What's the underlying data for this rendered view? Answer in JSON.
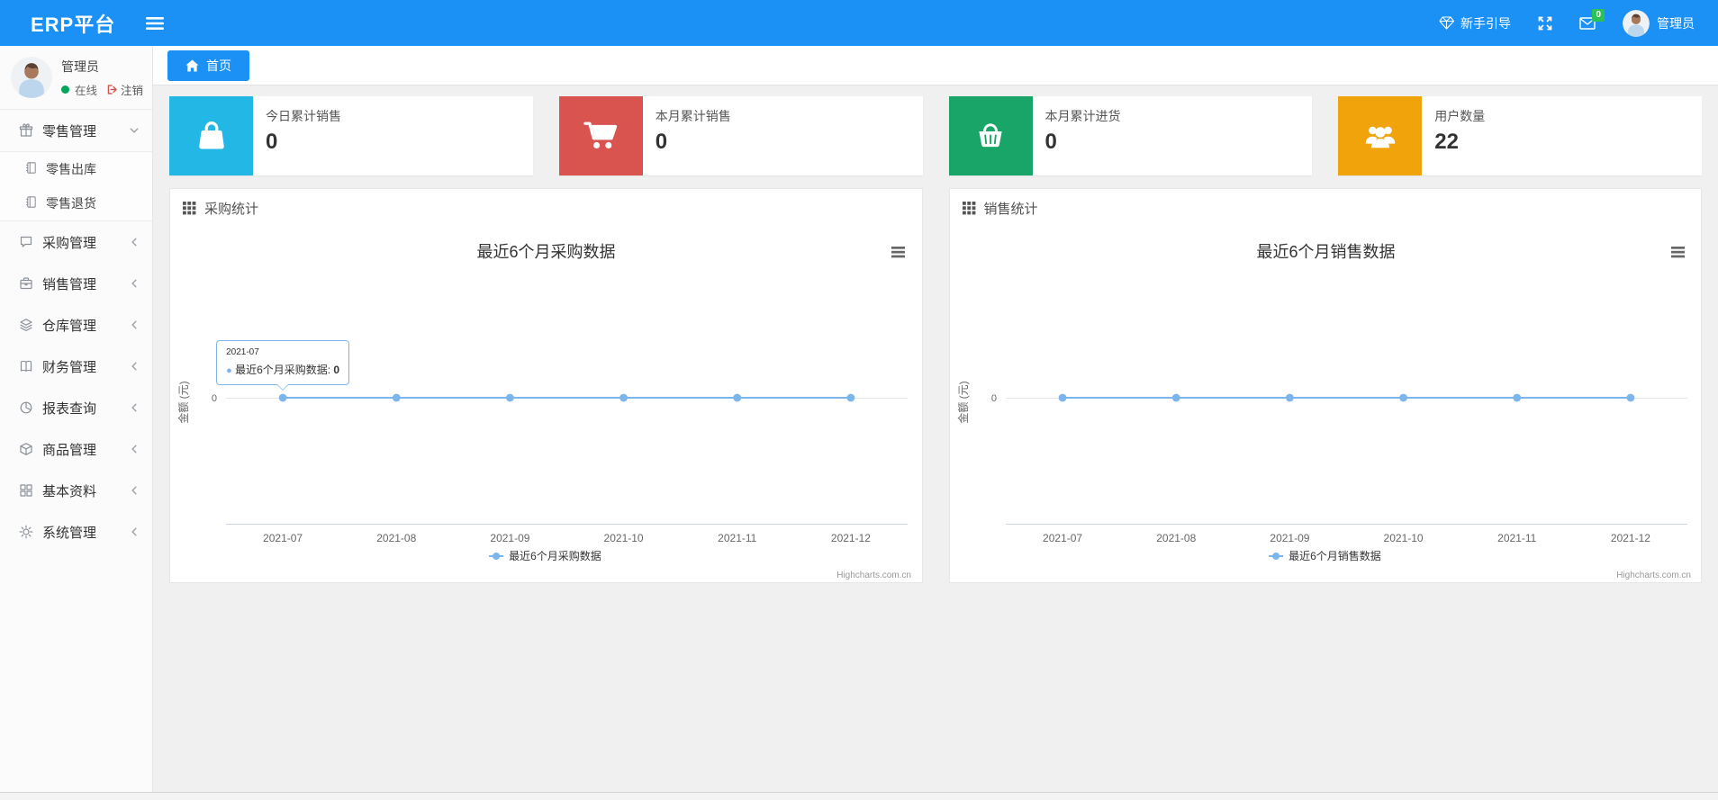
{
  "colors": {
    "accent": "#1b90f5",
    "chart_line": "#7cb5ec",
    "badge_green": "#2bc155",
    "online_green": "#00a65a"
  },
  "navbar": {
    "brand": "ERP平台",
    "guide_label": "新手引导",
    "mail_badge": "0",
    "user_name": "管理员",
    "toggle_icon": "hamburger-icon",
    "guide_icon": "gem-icon",
    "fullscreen_icon": "expand-icon",
    "mail_icon": "mail-icon",
    "avatar_icon": "avatar-icon"
  },
  "sidebar": {
    "user": {
      "name": "管理员",
      "status": "在线",
      "logout": "注销",
      "avatar_icon": "avatar-icon",
      "logout_icon": "signout-icon"
    },
    "menu": [
      {
        "label": "零售管理",
        "icon": "gift-icon",
        "arrow": "chevron-down-icon",
        "children": [
          {
            "label": "零售出库",
            "icon": "journal-icon"
          },
          {
            "label": "零售退货",
            "icon": "journal-icon"
          }
        ]
      },
      {
        "label": "采购管理",
        "icon": "chat-icon",
        "arrow": "chevron-left-icon"
      },
      {
        "label": "销售管理",
        "icon": "briefcase-icon",
        "arrow": "chevron-left-icon"
      },
      {
        "label": "仓库管理",
        "icon": "layers-icon",
        "arrow": "chevron-left-icon"
      },
      {
        "label": "财务管理",
        "icon": "book-icon",
        "arrow": "chevron-left-icon"
      },
      {
        "label": "报表查询",
        "icon": "pie-chart-icon",
        "arrow": "chevron-left-icon"
      },
      {
        "label": "商品管理",
        "icon": "box-icon",
        "arrow": "chevron-left-icon"
      },
      {
        "label": "基本资料",
        "icon": "grid-icon",
        "arrow": "chevron-left-icon"
      },
      {
        "label": "系统管理",
        "icon": "gear-icon",
        "arrow": "chevron-left-icon"
      }
    ]
  },
  "tabs": {
    "home": "首页",
    "home_icon": "home-icon"
  },
  "stat_cards": [
    {
      "label": "今日累计销售",
      "value": "0",
      "color": "#23b7e5",
      "icon": "shopping-bag-icon"
    },
    {
      "label": "本月累计销售",
      "value": "0",
      "color": "#d9534f",
      "icon": "cart-icon"
    },
    {
      "label": "本月累计进货",
      "value": "0",
      "color": "#19a567",
      "icon": "basket-icon"
    },
    {
      "label": "用户数量",
      "value": "22",
      "color": "#f0a30a",
      "icon": "users-icon"
    }
  ],
  "panels": [
    {
      "title": "采购统计",
      "icon": "th-icon"
    },
    {
      "title": "销售统计",
      "icon": "th-icon"
    }
  ],
  "chart_data": [
    {
      "type": "line",
      "title": "最近6个月采购数据",
      "categories": [
        "2021-07",
        "2021-08",
        "2021-09",
        "2021-10",
        "2021-11",
        "2021-12"
      ],
      "series": [
        {
          "name": "最近6个月采购数据",
          "values": [
            0,
            0,
            0,
            0,
            0,
            0
          ]
        }
      ],
      "ylabel": "金额 (元)",
      "yticks": [
        "0"
      ],
      "ylim": [
        0,
        0
      ],
      "grid": true,
      "legend_position": "bottom",
      "line_color": "#7cb5ec",
      "credits": "Highcharts.com.cn",
      "tooltip": {
        "category": "2021-07",
        "series": "最近6个月采购数据",
        "value": "0"
      }
    },
    {
      "type": "line",
      "title": "最近6个月销售数据",
      "categories": [
        "2021-07",
        "2021-08",
        "2021-09",
        "2021-10",
        "2021-11",
        "2021-12"
      ],
      "series": [
        {
          "name": "最近6个月销售数据",
          "values": [
            0,
            0,
            0,
            0,
            0,
            0
          ]
        }
      ],
      "ylabel": "金额 (元)",
      "yticks": [
        "0"
      ],
      "ylim": [
        0,
        0
      ],
      "grid": true,
      "legend_position": "bottom",
      "line_color": "#7cb5ec",
      "credits": "Highcharts.com.cn"
    }
  ]
}
